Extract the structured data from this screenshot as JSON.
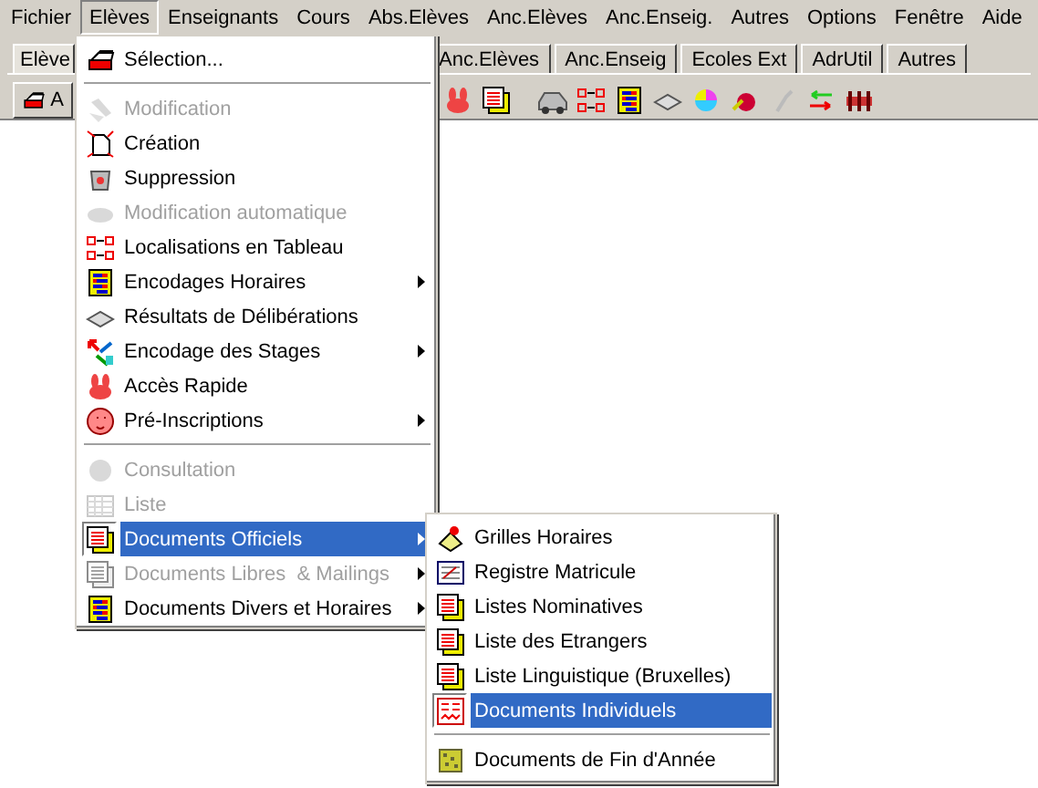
{
  "menubar": [
    {
      "label": "Fichier",
      "selected": false
    },
    {
      "label": "Elèves",
      "selected": true
    },
    {
      "label": "Enseignants",
      "selected": false
    },
    {
      "label": "Cours",
      "selected": false
    },
    {
      "label": "Abs.Elèves",
      "selected": false
    },
    {
      "label": "Anc.Elèves",
      "selected": false
    },
    {
      "label": "Anc.Enseig.",
      "selected": false
    },
    {
      "label": "Autres",
      "selected": false
    },
    {
      "label": "Options",
      "selected": false
    },
    {
      "label": "Fenêtre",
      "selected": false
    },
    {
      "label": "Aide",
      "selected": false
    }
  ],
  "tabs": [
    {
      "label": "Elève",
      "selected": true
    },
    {
      "label": "Anc.Elèves",
      "selected": false
    },
    {
      "label": "Anc.Enseig",
      "selected": false
    },
    {
      "label": "Ecoles Ext",
      "selected": false
    },
    {
      "label": "AdrUtil",
      "selected": false
    },
    {
      "label": "Autres",
      "selected": false
    }
  ],
  "toolbar": {
    "first_button": "A"
  },
  "menu": {
    "items": [
      {
        "kind": "item",
        "label": "Sélection...",
        "disabled": false,
        "selected": false,
        "submenu": false
      },
      {
        "kind": "separator"
      },
      {
        "kind": "item",
        "label": "Modification",
        "disabled": true,
        "selected": false,
        "submenu": false
      },
      {
        "kind": "item",
        "label": "Création",
        "disabled": false,
        "selected": false,
        "submenu": false
      },
      {
        "kind": "item",
        "label": "Suppression",
        "disabled": false,
        "selected": false,
        "submenu": false
      },
      {
        "kind": "item",
        "label": "Modification automatique",
        "disabled": true,
        "selected": false,
        "submenu": false
      },
      {
        "kind": "item",
        "label": "Localisations en Tableau",
        "disabled": false,
        "selected": false,
        "submenu": false
      },
      {
        "kind": "item",
        "label": "Encodages Horaires",
        "disabled": false,
        "selected": false,
        "submenu": true
      },
      {
        "kind": "item",
        "label": "Résultats de Délibérations",
        "disabled": false,
        "selected": false,
        "submenu": false
      },
      {
        "kind": "item",
        "label": "Encodage des Stages",
        "disabled": false,
        "selected": false,
        "submenu": true
      },
      {
        "kind": "item",
        "label": "Accès Rapide",
        "disabled": false,
        "selected": false,
        "submenu": false
      },
      {
        "kind": "item",
        "label": "Pré-Inscriptions",
        "disabled": false,
        "selected": false,
        "submenu": true
      },
      {
        "kind": "separator"
      },
      {
        "kind": "item",
        "label": "Consultation",
        "disabled": true,
        "selected": false,
        "submenu": false
      },
      {
        "kind": "item",
        "label": "Liste",
        "disabled": true,
        "selected": false,
        "submenu": false
      },
      {
        "kind": "item",
        "label": "Documents Officiels",
        "disabled": false,
        "selected": true,
        "submenu": true
      },
      {
        "kind": "item",
        "label": "Documents Libres  & Mailings",
        "disabled": true,
        "selected": false,
        "submenu": true
      },
      {
        "kind": "item",
        "label": "Documents Divers et Horaires",
        "disabled": false,
        "selected": false,
        "submenu": true
      }
    ]
  },
  "submenu": {
    "items": [
      {
        "kind": "item",
        "label": "Grilles Horaires",
        "disabled": false,
        "selected": false,
        "submenu": false
      },
      {
        "kind": "item",
        "label": "Registre Matricule",
        "disabled": false,
        "selected": false,
        "submenu": false
      },
      {
        "kind": "item",
        "label": "Listes Nominatives",
        "disabled": false,
        "selected": false,
        "submenu": false
      },
      {
        "kind": "item",
        "label": "Liste des Etrangers",
        "disabled": false,
        "selected": false,
        "submenu": false
      },
      {
        "kind": "item",
        "label": "Liste Linguistique (Bruxelles)",
        "disabled": false,
        "selected": false,
        "submenu": false
      },
      {
        "kind": "item",
        "label": "Documents Individuels",
        "disabled": false,
        "selected": true,
        "submenu": false
      },
      {
        "kind": "separator"
      },
      {
        "kind": "item",
        "label": "Documents de Fin d'Année",
        "disabled": false,
        "selected": false,
        "submenu": false
      }
    ]
  }
}
